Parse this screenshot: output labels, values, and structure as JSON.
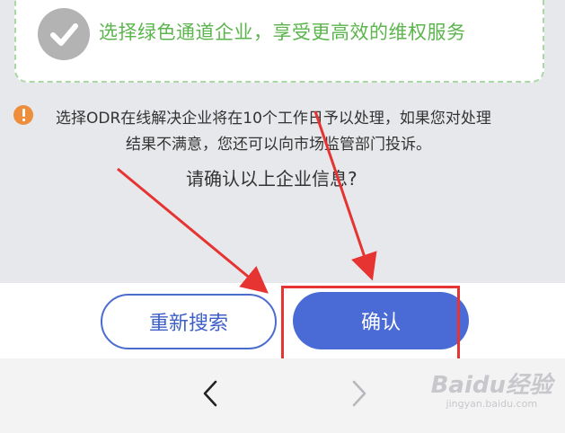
{
  "green_option": {
    "text": "选择绿色通道企业，享受更高效的维权服务",
    "icon": "check-icon"
  },
  "notice": {
    "line1": "选择ODR在线解决企业将在10个工作日予以处理，如果您对处理",
    "line2": "结果不满意，您还可以向市场监管部门投诉。",
    "icon": "warning-icon"
  },
  "confirm_question": "请确认以上企业信息?",
  "buttons": {
    "research_label": "重新搜索",
    "confirm_label": "确认"
  },
  "bottom_nav": {
    "back_icon": "chevron-left-icon",
    "forward_icon": "chevron-right-icon"
  },
  "watermark": {
    "logo": "Baidu经验",
    "url": "jingyan.baidu.com"
  },
  "colors": {
    "accent_blue": "#4a6bd6",
    "green_text": "#5bb54c",
    "warning_orange": "#ee8e3c",
    "annotation_red": "#e53431"
  }
}
